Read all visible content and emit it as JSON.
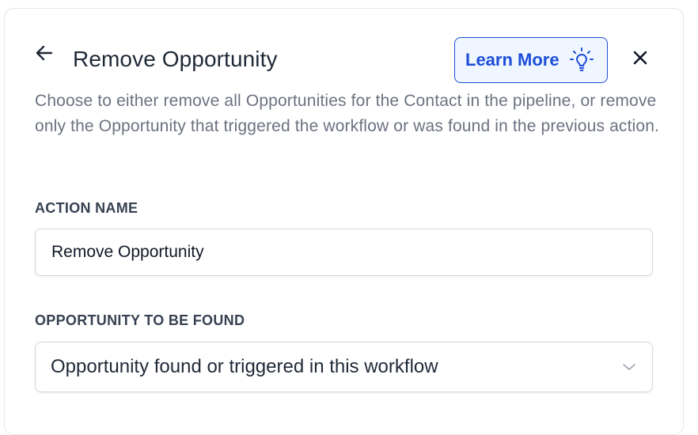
{
  "header": {
    "title": "Remove Opportunity",
    "learn_more_label": "Learn More",
    "back_icon": "arrow-left-icon",
    "close_icon": "close-icon",
    "learn_more_icon": "lightbulb-icon"
  },
  "description": "Choose to either remove all Opportunities for the Contact in the pipeline, or remove only the Opportunity that triggered the workflow or was found in the previous action.",
  "action_name": {
    "label": "ACTION NAME",
    "value": "Remove Opportunity"
  },
  "opportunity_to_be_found": {
    "label": "OPPORTUNITY TO BE FOUND",
    "selected": "Opportunity found or triggered in this workflow",
    "chevron_icon": "chevron-down-icon"
  },
  "colors": {
    "accent": "#1d4ed8",
    "accent_bg": "#eff6ff",
    "title": "#1f2937",
    "muted_text": "#6b7280",
    "border": "#d1d5db"
  }
}
